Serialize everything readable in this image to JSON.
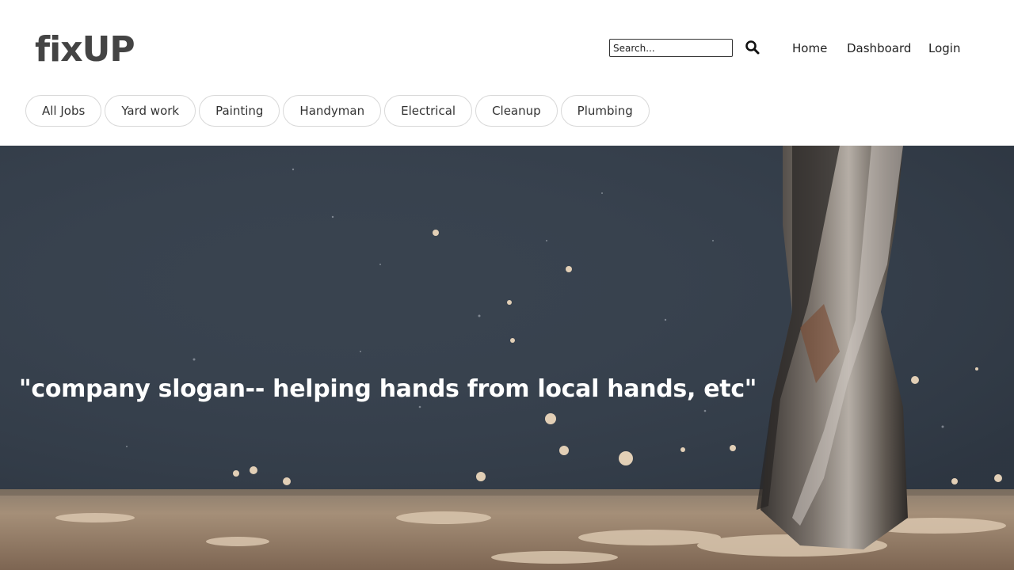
{
  "header": {
    "logo": "fixUP",
    "search": {
      "placeholder": "Search..."
    },
    "nav": {
      "home": "Home",
      "dashboard": "Dashboard",
      "login": "Login"
    }
  },
  "categories": [
    "All Jobs",
    "Yard work",
    "Painting",
    "Handyman",
    "Electrical",
    "Cleanup",
    "Plumbing"
  ],
  "hero": {
    "slogan": "\"company slogan-- helping hands from local hands, etc\"",
    "image": "drill-bit-sawdust-photo"
  },
  "colors": {
    "logo": "#444444",
    "hero_sky": "#3a4555",
    "hero_floor": "#b49f88"
  },
  "icons": {
    "search": "search-icon"
  }
}
